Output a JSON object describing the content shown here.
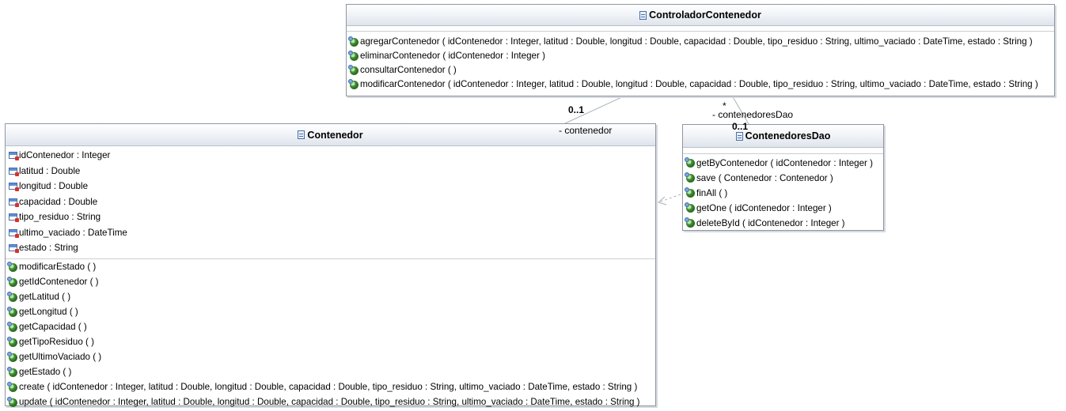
{
  "classes": {
    "controlador": {
      "name": "ControladorContenedor",
      "operations": [
        "agregarContenedor ( idContenedor : Integer, latitud : Double, longitud : Double, capacidad : Double, tipo_residuo : String, ultimo_vaciado : DateTime, estado : String )",
        "eliminarContenedor ( idContenedor : Integer )",
        "consultarContenedor ( )",
        "modificarContenedor ( idContenedor : Integer, latitud : Double, longitud : Double, capacidad : Double, tipo_residuo : String, ultimo_vaciado : DateTime, estado : String )"
      ]
    },
    "contenedor": {
      "name": "Contenedor",
      "attributes": [
        "idContenedor : Integer",
        "latitud : Double",
        "longitud : Double",
        "capacidad : Double",
        "tipo_residuo : String",
        "ultimo_vaciado : DateTime",
        "estado : String"
      ],
      "operations": [
        "modificarEstado ( )",
        "getIdContenedor ( )",
        "getLatitud ( )",
        "getLongitud ( )",
        "getCapacidad ( )",
        "getTipoResiduo ( )",
        "getUltimoVaciado ( )",
        "getEstado ( )",
        "create ( idContenedor : Integer, latitud : Double, longitud : Double, capacidad : Double, tipo_residuo : String, ultimo_vaciado : DateTime, estado : String )",
        "update ( idContenedor : Integer, latitud : Double, longitud : Double, capacidad : Double, tipo_residuo : String, ultimo_vaciado : DateTime, estado : String )"
      ]
    },
    "dao": {
      "name": "ContenedoresDao",
      "operations": [
        "getByContenedor ( idContenedor : Integer )",
        "save ( Contenedor : Contenedor )",
        "finAll ( )",
        "getOne ( idContenedor : Integer )",
        "deleteById ( idContenedor : Integer )"
      ]
    }
  },
  "associations": {
    "to_contenedor": {
      "multiplicity": "0..1",
      "role": "- contenedor"
    },
    "to_dao": {
      "multiplicity_near_source": "*",
      "role": "- contenedoresDao",
      "multiplicity_near_target": "0..1"
    }
  }
}
